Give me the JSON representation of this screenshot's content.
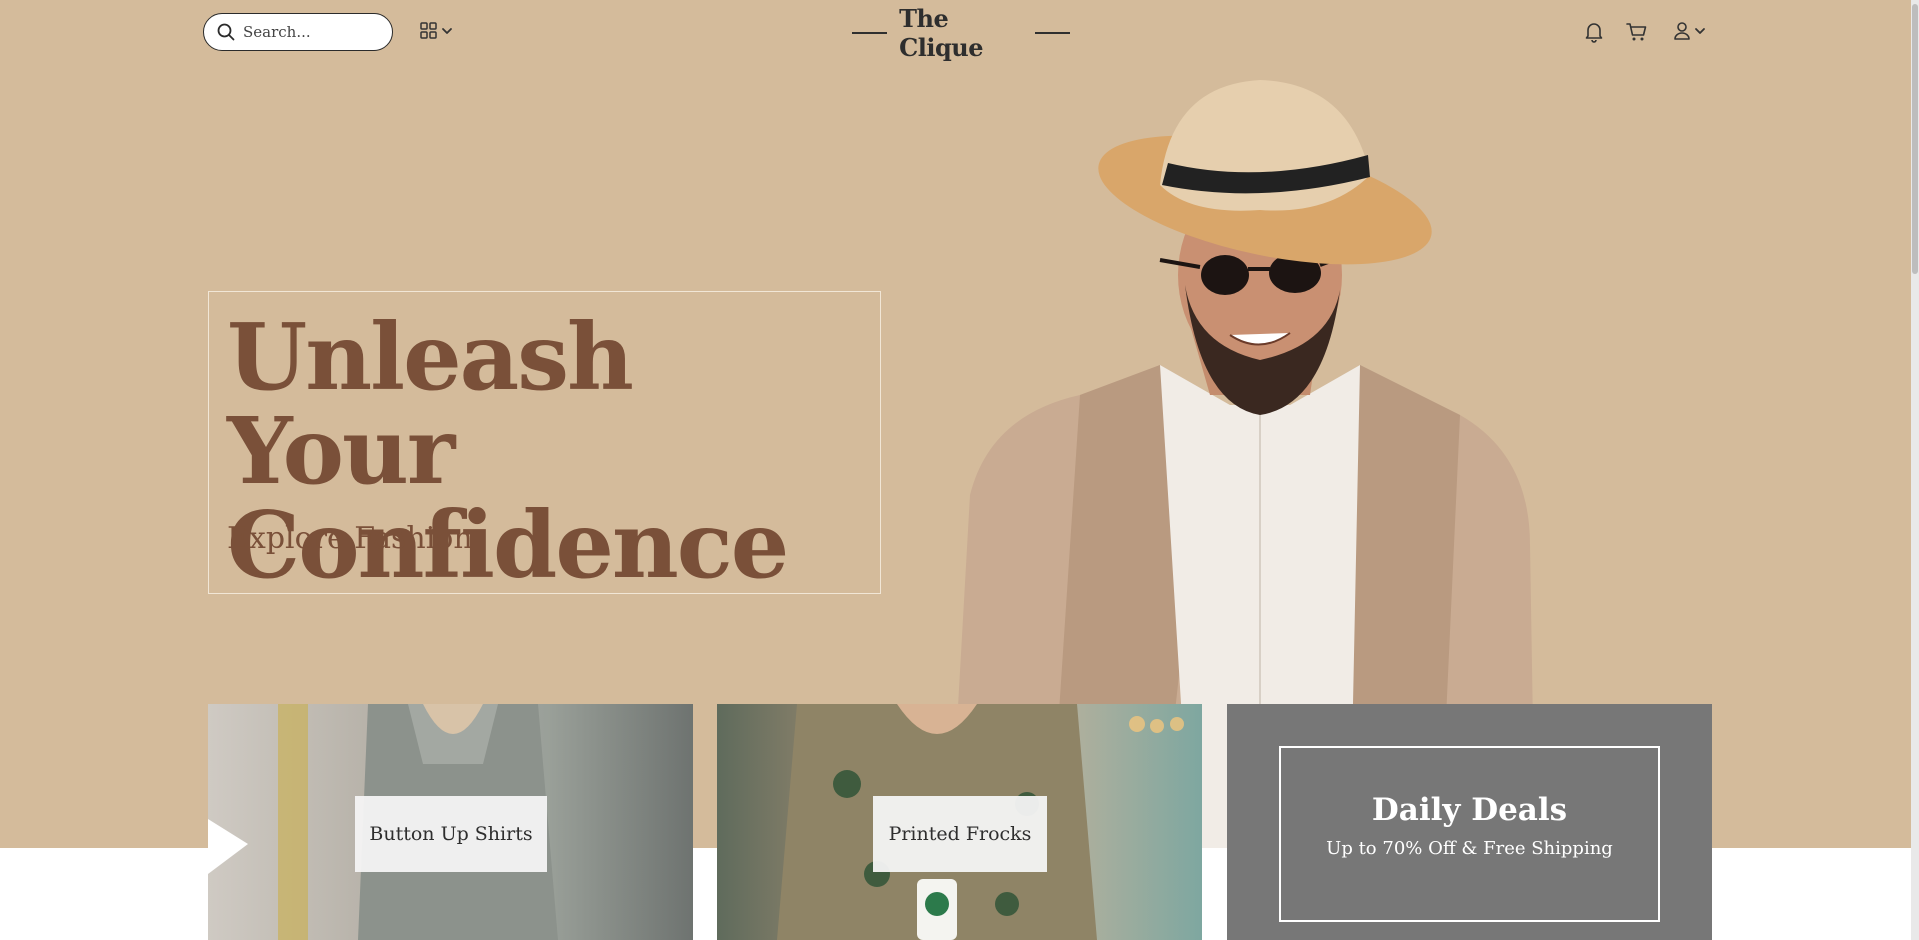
{
  "header": {
    "search_placeholder": "Search...",
    "brand_name": "The Clique",
    "icons": [
      "search-icon",
      "grid-icon",
      "chevron-down-icon",
      "bell-icon",
      "cart-icon",
      "user-icon"
    ]
  },
  "hero": {
    "headline": "Unleash Your\nConfidence",
    "subline": "Explore Fashion"
  },
  "cards": [
    {
      "label": "Button Up Shirts"
    },
    {
      "label": "Printed Frocks"
    },
    {
      "title": "Daily Deals",
      "subtitle": "Up to 70% Off & Free Shipping"
    }
  ],
  "colors": {
    "hero_background": "#d4bb9b",
    "headline": "#7a5039",
    "deal_card": "#777777",
    "brand_text": "#2e2e2e"
  }
}
